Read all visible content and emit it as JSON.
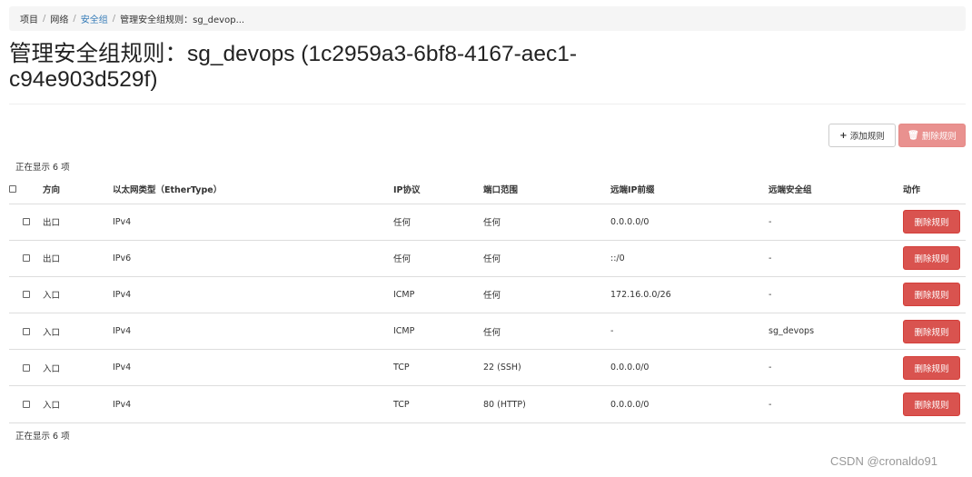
{
  "breadcrumb": {
    "items": [
      "项目",
      "网络",
      "安全组",
      "管理安全组规则：sg_devop..."
    ],
    "separator": "/"
  },
  "page_title": "管理安全组规则：sg_devops (1c2959a3-6bf8-4167-aec1-c94e903d529f)",
  "toolbar": {
    "add_label": "添加规则",
    "add_icon": "+",
    "delete_label": "删除规则",
    "delete_icon": "🗑"
  },
  "table": {
    "count_top": "正在显示 6 项",
    "count_bottom": "正在显示 6 项",
    "headers": {
      "direction": "方向",
      "ethertype": "以太网类型（EtherType）",
      "ip_protocol": "IP协议",
      "port_range": "端口范围",
      "remote_ip_prefix": "远端IP前缀",
      "remote_group": "远端安全组",
      "actions": "动作"
    },
    "rows": [
      {
        "direction": "出口",
        "ethertype": "IPv4",
        "ip_protocol": "任何",
        "port_range": "任何",
        "remote_ip_prefix": "0.0.0.0/0",
        "remote_group": "-",
        "action_label": "删除规则"
      },
      {
        "direction": "出口",
        "ethertype": "IPv6",
        "ip_protocol": "任何",
        "port_range": "任何",
        "remote_ip_prefix": "::/0",
        "remote_group": "-",
        "action_label": "删除规则"
      },
      {
        "direction": "入口",
        "ethertype": "IPv4",
        "ip_protocol": "ICMP",
        "port_range": "任何",
        "remote_ip_prefix": "172.16.0.0/26",
        "remote_group": "-",
        "action_label": "删除规则"
      },
      {
        "direction": "入口",
        "ethertype": "IPv4",
        "ip_protocol": "ICMP",
        "port_range": "任何",
        "remote_ip_prefix": "-",
        "remote_group": "sg_devops",
        "action_label": "删除规则"
      },
      {
        "direction": "入口",
        "ethertype": "IPv4",
        "ip_protocol": "TCP",
        "port_range": "22 (SSH)",
        "remote_ip_prefix": "0.0.0.0/0",
        "remote_group": "-",
        "action_label": "删除规则"
      },
      {
        "direction": "入口",
        "ethertype": "IPv4",
        "ip_protocol": "TCP",
        "port_range": "80 (HTTP)",
        "remote_ip_prefix": "0.0.0.0/0",
        "remote_group": "-",
        "action_label": "删除规则"
      }
    ]
  },
  "watermark": "CSDN @cronaldo91",
  "colors": {
    "link": "#337ab7",
    "danger": "#d9534f",
    "danger_disabled": "#e9918f",
    "breadcrumb_bg": "#f5f5f5"
  }
}
